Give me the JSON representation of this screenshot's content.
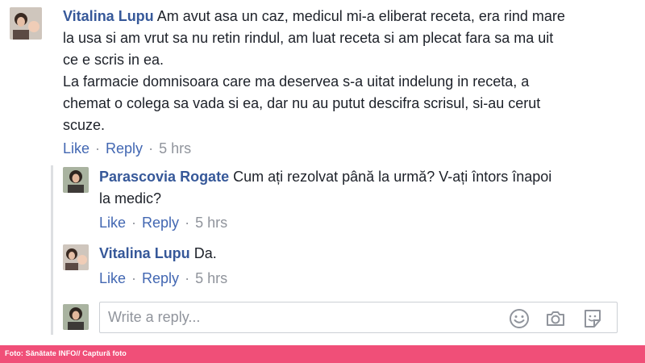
{
  "comments": [
    {
      "author": "Vitalina Lupu",
      "lines": [
        "Am avut asa un caz, medicul mi-a eliberat receta, era rind mare",
        "la usa si am vrut sa nu retin rindul, am luat receta si am plecat fara sa ma uit",
        "ce e scris in ea.",
        "La farmacie domnisoara care ma deservea s-a uitat indelung in receta, a",
        "chemat o colega sa vada si ea, dar nu au putut descifra scrisul, si-au cerut",
        "scuze."
      ],
      "like": "Like",
      "reply": "Reply",
      "time": "5 hrs"
    },
    {
      "author": "Parascovia Rogate",
      "lines": [
        "Cum ați rezolvat până la urmă? V-ați întors înapoi",
        "la medic?"
      ],
      "like": "Like",
      "reply": "Reply",
      "time": "5 hrs"
    },
    {
      "author": "Vitalina Lupu",
      "lines": [
        "Da."
      ],
      "like": "Like",
      "reply": "Reply",
      "time": "5 hrs"
    }
  ],
  "reply_box": {
    "placeholder": "Write a reply...",
    "icons": [
      "smiley-icon",
      "camera-icon",
      "sticker-icon"
    ]
  },
  "credit": "Foto: Sănătate INFO// Captură foto",
  "colors": {
    "author": "#365899",
    "link": "#4267b2",
    "muted": "#90949c",
    "credit_bar": "#f04f78"
  }
}
